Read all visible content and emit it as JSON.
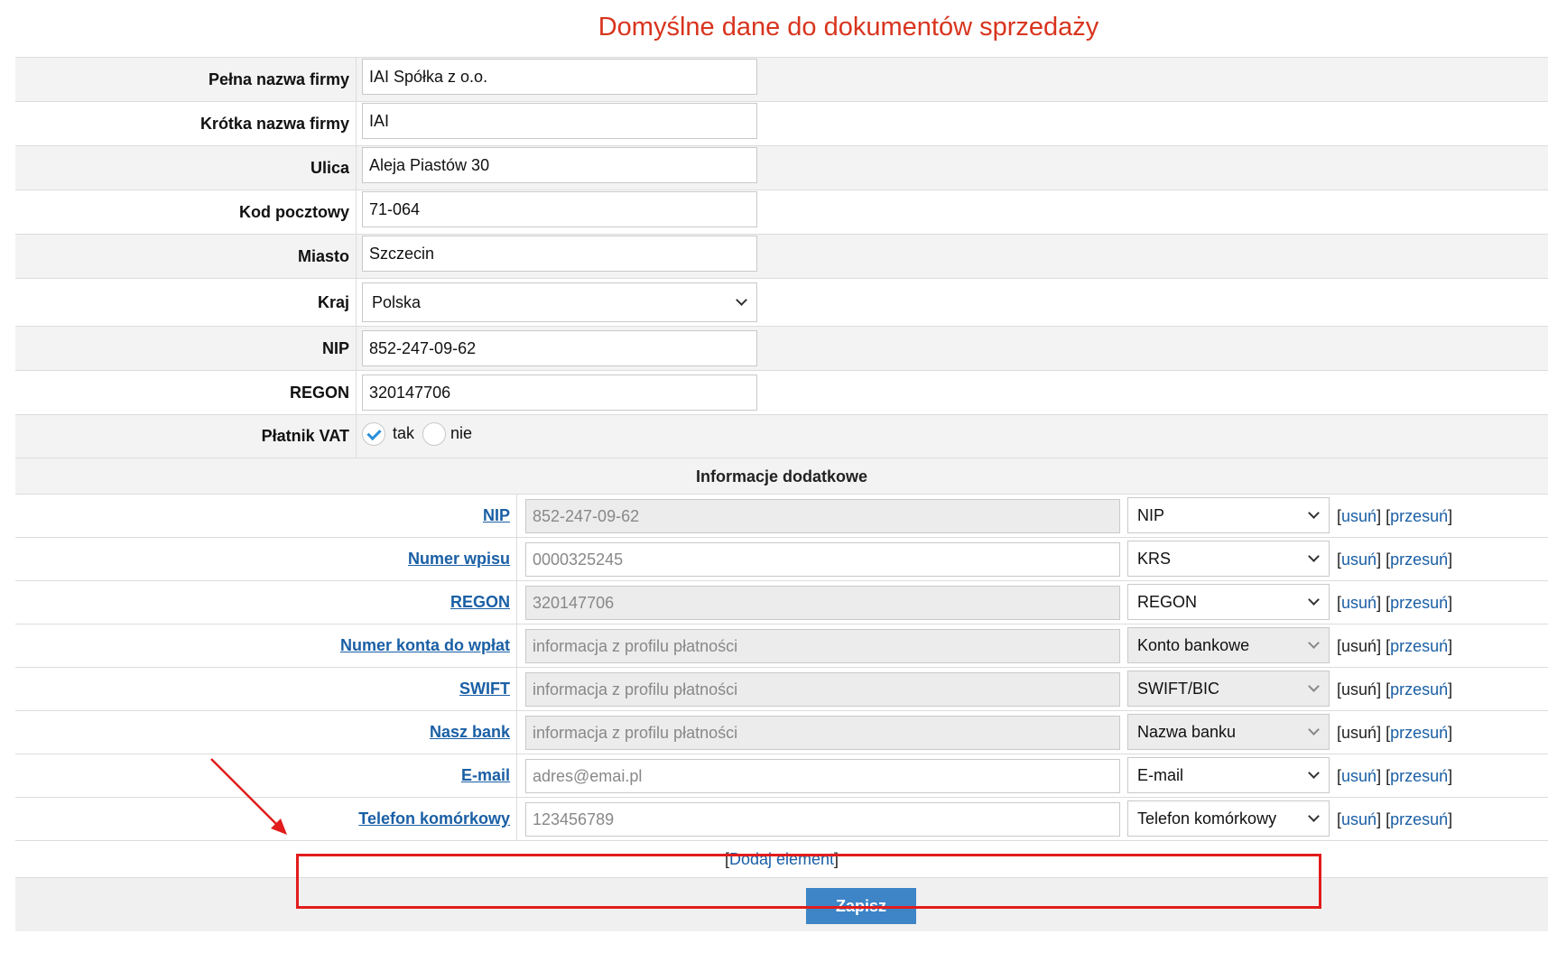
{
  "page": {
    "title": "Domyślne dane do dokumentów sprzedaży"
  },
  "company": [
    {
      "label": "Pełna nazwa firmy",
      "value": "IAI Spółka z o.o."
    },
    {
      "label": "Krótka nazwa firmy",
      "value": "IAI"
    },
    {
      "label": "Ulica",
      "value": "Aleja Piastów 30"
    },
    {
      "label": "Kod pocztowy",
      "value": "71-064"
    },
    {
      "label": "Miasto",
      "value": "Szczecin"
    }
  ],
  "country": {
    "label": "Kraj",
    "value": "Polska"
  },
  "tax": [
    {
      "label": "NIP",
      "value": "852-247-09-62"
    },
    {
      "label": "REGON",
      "value": "320147706"
    }
  ],
  "vat": {
    "label": "Płatnik VAT",
    "yes_label": "tak",
    "no_label": "nie",
    "selected": "tak"
  },
  "additional": {
    "header": "Informacje dodatkowe",
    "rows": [
      {
        "label": "NIP",
        "value": "852-247-09-62",
        "type": "NIP",
        "remove": "usuń",
        "move": "przesuń"
      },
      {
        "label": "Numer wpisu",
        "value": "0000325245",
        "type": "KRS",
        "remove": "usuń",
        "move": "przesuń"
      },
      {
        "label": "REGON",
        "value": "320147706",
        "type": "REGON",
        "remove": "usuń",
        "move": "przesuń"
      },
      {
        "label": "Numer konta do wpłat",
        "value": "informacja z profilu płatności",
        "type": "Konto bankowe",
        "remove": "usuń",
        "move": "przesuń"
      },
      {
        "label": "SWIFT",
        "value": "informacja z profilu płatności",
        "type": "SWIFT/BIC",
        "remove": "usuń",
        "move": "przesuń"
      },
      {
        "label": "Nasz bank",
        "value": "informacja z profilu płatności",
        "type": "Nazwa banku",
        "remove": "usuń",
        "move": "przesuń"
      },
      {
        "label": "E-mail",
        "value": "adres@emai.pl",
        "type": "E-mail",
        "remove": "usuń",
        "move": "przesuń"
      },
      {
        "label": "Telefon komórkowy",
        "value": "123456789",
        "type": "Telefon komórkowy",
        "remove": "usuń",
        "move": "przesuń"
      }
    ],
    "add_label": "Dodaj element"
  },
  "save": {
    "label": "Zapisz"
  },
  "annotation_color": "#e21c1c"
}
